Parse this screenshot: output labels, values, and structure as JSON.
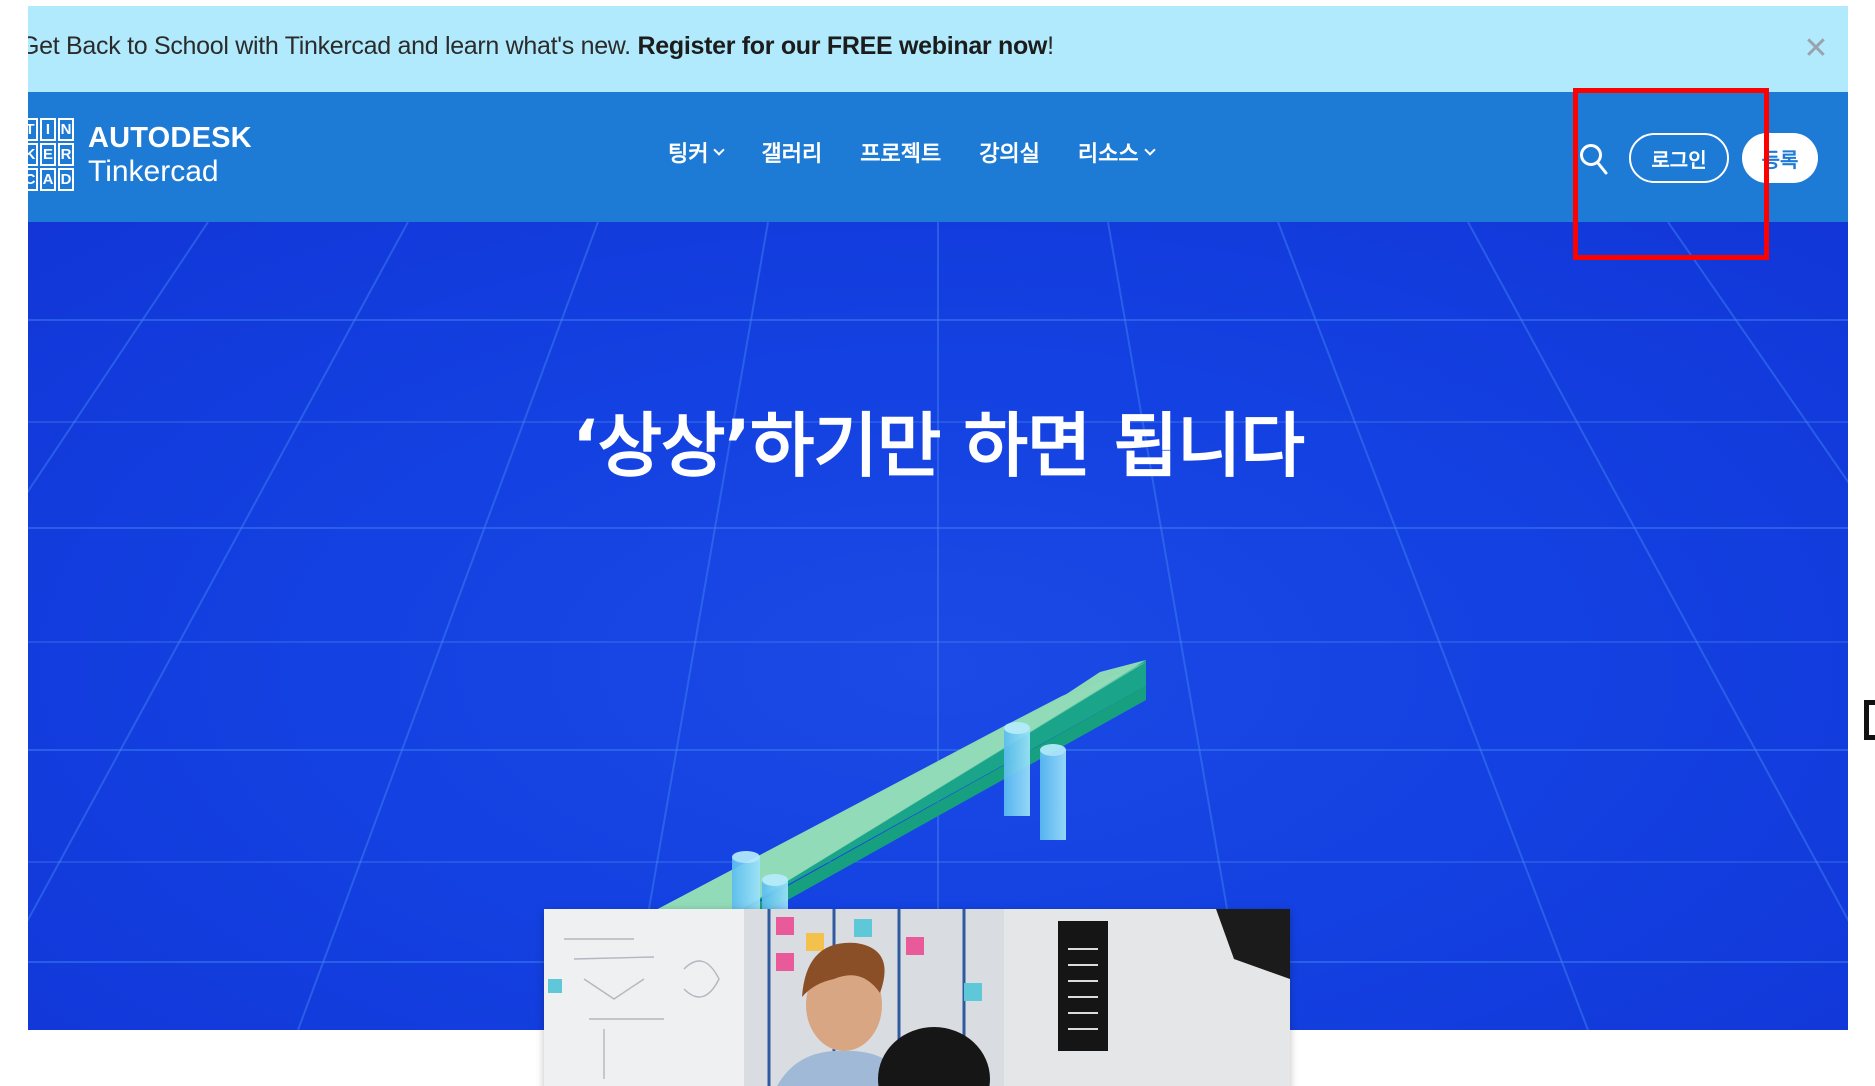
{
  "banner": {
    "text_prefix": "Get Back to School with Tinkercad and learn what's new. ",
    "text_link": "Register for our FREE webinar now",
    "text_suffix": "!",
    "close_glyph": "✕"
  },
  "logo": {
    "letters": [
      "T",
      "I",
      "N",
      "K",
      "E",
      "R",
      "C",
      "A",
      "D"
    ],
    "brand": "AUTODESK",
    "product": "Tinkercad"
  },
  "nav": {
    "items": [
      {
        "label": "팅커",
        "has_caret": true
      },
      {
        "label": "갤러리",
        "has_caret": false
      },
      {
        "label": "프로젝트",
        "has_caret": false
      },
      {
        "label": "강의실",
        "has_caret": false
      },
      {
        "label": "리소스",
        "has_caret": true
      }
    ]
  },
  "actions": {
    "login_label": "로그인",
    "signup_label": "등록"
  },
  "hero": {
    "title": "‘상상’하기만 하면 됩니다"
  },
  "colors": {
    "banner_bg": "#b0eafc",
    "header_bg": "#1d7ad5",
    "hero_bg": "#1442e2",
    "highlight": "#ff0000",
    "seesaw_top": "#8fd9b6",
    "seesaw_side": "#1aa58a",
    "peg": "#7fd0f5"
  }
}
